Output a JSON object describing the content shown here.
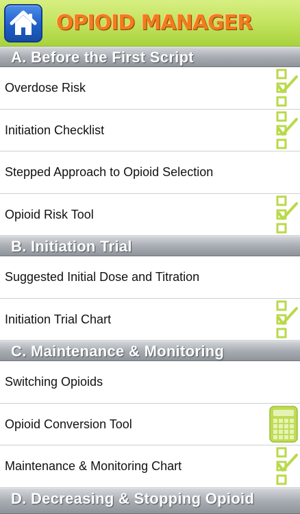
{
  "header": {
    "title": "OPIOID MANAGER",
    "home_icon": "home-icon"
  },
  "colors": {
    "header_green": "#c2e35e",
    "title_orange": "#f07d1c",
    "section_gray": "#a8adb3",
    "icon_green": "#b9d94a",
    "home_blue": "#1e5fc9"
  },
  "sections": [
    {
      "title": "A.  Before the First Script",
      "items": [
        {
          "label": "Overdose Risk",
          "icon": "checklist-icon"
        },
        {
          "label": "Initiation Checklist",
          "icon": "checklist-icon"
        },
        {
          "label": "Stepped Approach to Opioid Selection",
          "icon": ""
        },
        {
          "label": "Opioid Risk Tool",
          "icon": "checklist-icon"
        }
      ]
    },
    {
      "title": "B.  Initiation Trial",
      "items": [
        {
          "label": "Suggested Initial Dose and Titration",
          "icon": ""
        },
        {
          "label": "Initiation Trial Chart",
          "icon": "checklist-icon"
        }
      ]
    },
    {
      "title": "C.  Maintenance & Monitoring",
      "items": [
        {
          "label": "Switching Opioids",
          "icon": ""
        },
        {
          "label": "Opioid Conversion Tool",
          "icon": "calculator-icon"
        },
        {
          "label": "Maintenance & Monitoring Chart",
          "icon": "checklist-icon"
        }
      ]
    },
    {
      "title": "D.  Decreasing & Stopping Opioid",
      "items": []
    }
  ]
}
